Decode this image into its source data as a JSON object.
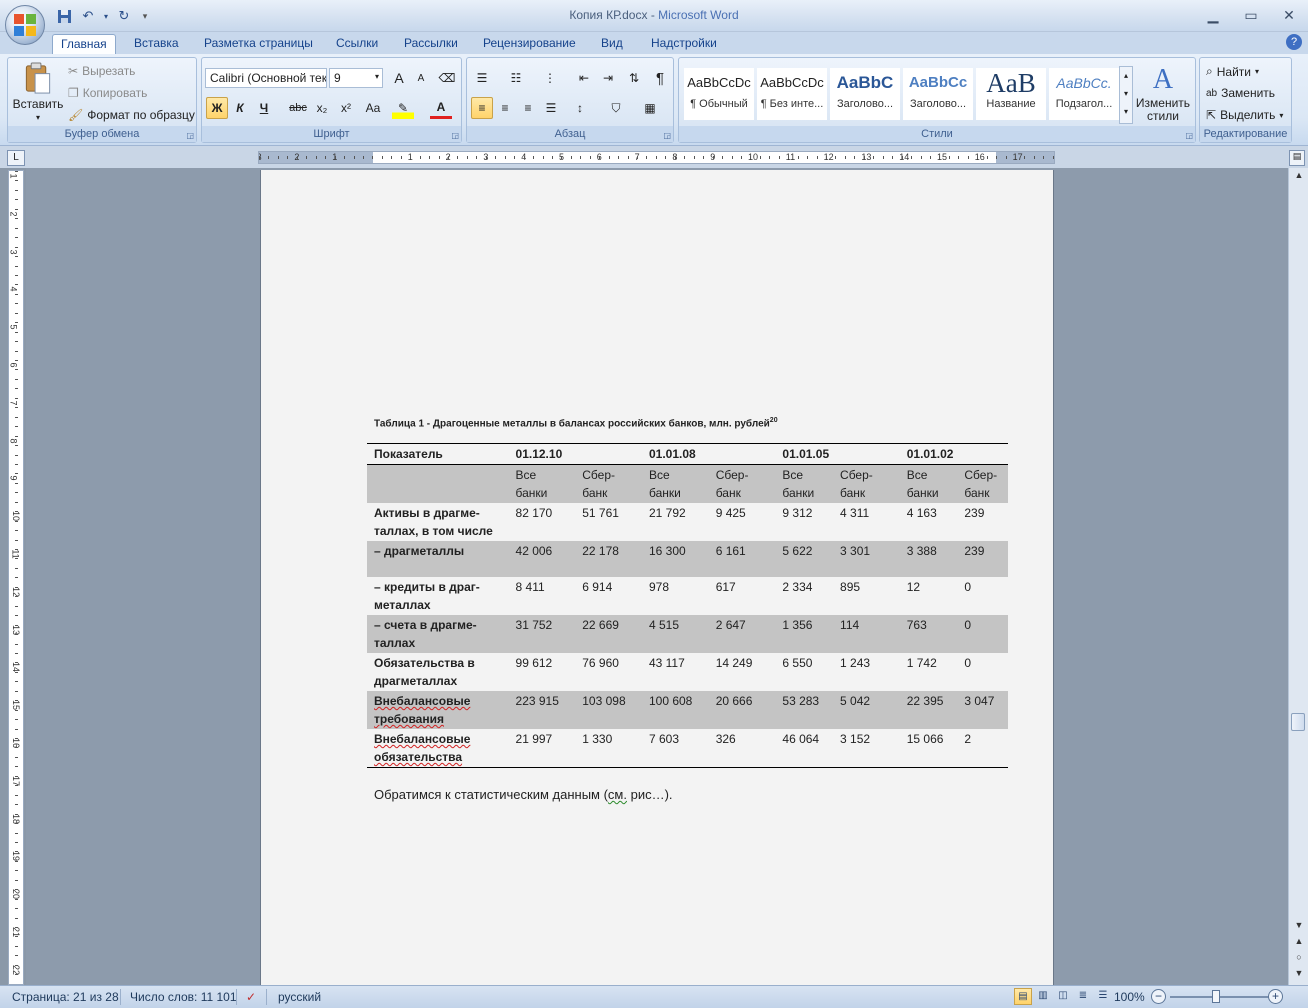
{
  "window": {
    "title_file": "Копия КР.docx",
    "title_sep": " - ",
    "title_app": "Microsoft Word",
    "min": "▁",
    "max": "▭",
    "close": "✕"
  },
  "tabs": [
    "Главная",
    "Вставка",
    "Разметка страницы",
    "Ссылки",
    "Рассылки",
    "Рецензирование",
    "Вид",
    "Надстройки"
  ],
  "help": "?",
  "clipboard": {
    "paste": "Вставить",
    "cut": "Вырезать",
    "copy": "Копировать",
    "format_painter": "Формат по образцу",
    "label": "Буфер обмена"
  },
  "font": {
    "name": "Calibri (Основной текст)",
    "size": "9",
    "bold": "Ж",
    "italic": "К",
    "underline": "Ч",
    "strike": "abc",
    "sub": "x₂",
    "sup": "x²",
    "case": "Aa",
    "grow": "A",
    "shrink": "A",
    "color": "A",
    "label": "Шрифт"
  },
  "paragraph": {
    "label": "Абзац",
    "pilcrow": "¶"
  },
  "styles": {
    "items": [
      {
        "sample": "AaBbCcDc",
        "name": "¶ Обычный"
      },
      {
        "sample": "AaBbCcDc",
        "name": "¶ Без инте..."
      },
      {
        "sample": "AaBbC",
        "name": "Заголово..."
      },
      {
        "sample": "AaBbCc",
        "name": "Заголово..."
      },
      {
        "sample": "AaB",
        "name": "Название"
      },
      {
        "sample": "AaBbCc.",
        "name": "Подзагол..."
      }
    ],
    "change": "Изменить стили",
    "label": "Стили"
  },
  "editing": {
    "find": "Найти",
    "replace": "Заменить",
    "select": "Выделить",
    "label": "Редактирование"
  },
  "document": {
    "caption": "Таблица 1 - Драгоценные металлы в балансах российских банков, млн. рублей",
    "caption_sup": "20",
    "table": {
      "header": [
        "Показатель",
        "01.12.10",
        "01.01.08",
        "01.01.05",
        "01.01.02"
      ],
      "sub": [
        "Все банки",
        "Сбер-банк",
        "Все банки",
        "Сбер-банк",
        "Все банки",
        "Сбер-банк",
        "Все банки",
        "Сбер-банк"
      ],
      "rows": [
        {
          "label": "Активы в драгме-таллах, в том числе",
          "values": [
            "82 170",
            "51 761",
            "21 792",
            "9 425",
            "9 312",
            "4 311",
            "4 163",
            "239"
          ]
        },
        {
          "label": "– драгметаллы",
          "values": [
            "42 006",
            "22 178",
            "16 300",
            "6 161",
            "5 622",
            "3 301",
            "3 388",
            "239"
          ]
        },
        {
          "label": "– кредиты в драг-металлах",
          "values": [
            "8 411",
            "6 914",
            "978",
            "617",
            "2 334",
            "895",
            "12",
            "0"
          ]
        },
        {
          "label": "– счета в драгме-таллах",
          "values": [
            "31 752",
            "22 669",
            "4 515",
            "2 647",
            "1 356",
            "114",
            "763",
            "0"
          ]
        },
        {
          "label": "Обязательства в драгметаллах",
          "values": [
            "99 612",
            "76 960",
            "43 117",
            "14 249",
            "6 550",
            "1 243",
            "1 742",
            "0"
          ]
        },
        {
          "label": "Внебалансовые требования",
          "values": [
            "223 915",
            "103 098",
            "100 608",
            "20 666",
            "53 283",
            "5 042",
            "22 395",
            "3 047"
          ]
        },
        {
          "label": "Внебалансовые обязательства",
          "values": [
            "21 997",
            "1 330",
            "7 603",
            "326",
            "46 064",
            "3 152",
            "15 066",
            "2"
          ]
        }
      ]
    },
    "para_a": "Обратимся к статистическим данным (",
    "para_b": "см.",
    "para_c": " рис…)."
  },
  "status": {
    "page": "Страница: 21 из 28",
    "words": "Число слов: 11 101",
    "lang": "русский",
    "zoom": "100%"
  },
  "ruler": {
    "h_labels": [
      "3",
      "2",
      "1",
      "1",
      "2",
      "3",
      "4",
      "5",
      "6",
      "7",
      "8",
      "9",
      "10",
      "11",
      "12",
      "13",
      "14",
      "15",
      "16",
      "17"
    ],
    "v_labels": [
      "1",
      "2",
      "3",
      "4",
      "5",
      "6",
      "7",
      "8",
      "9",
      "10",
      "11",
      "12",
      "13",
      "14",
      "15",
      "16",
      "17",
      "18",
      "19",
      "20",
      "21",
      "22"
    ]
  },
  "colors": {
    "accent": "#15428b",
    "ribbon": "#dbe7f5",
    "workspace": "#8d9bac",
    "table_shade": "#c4c4c4"
  }
}
